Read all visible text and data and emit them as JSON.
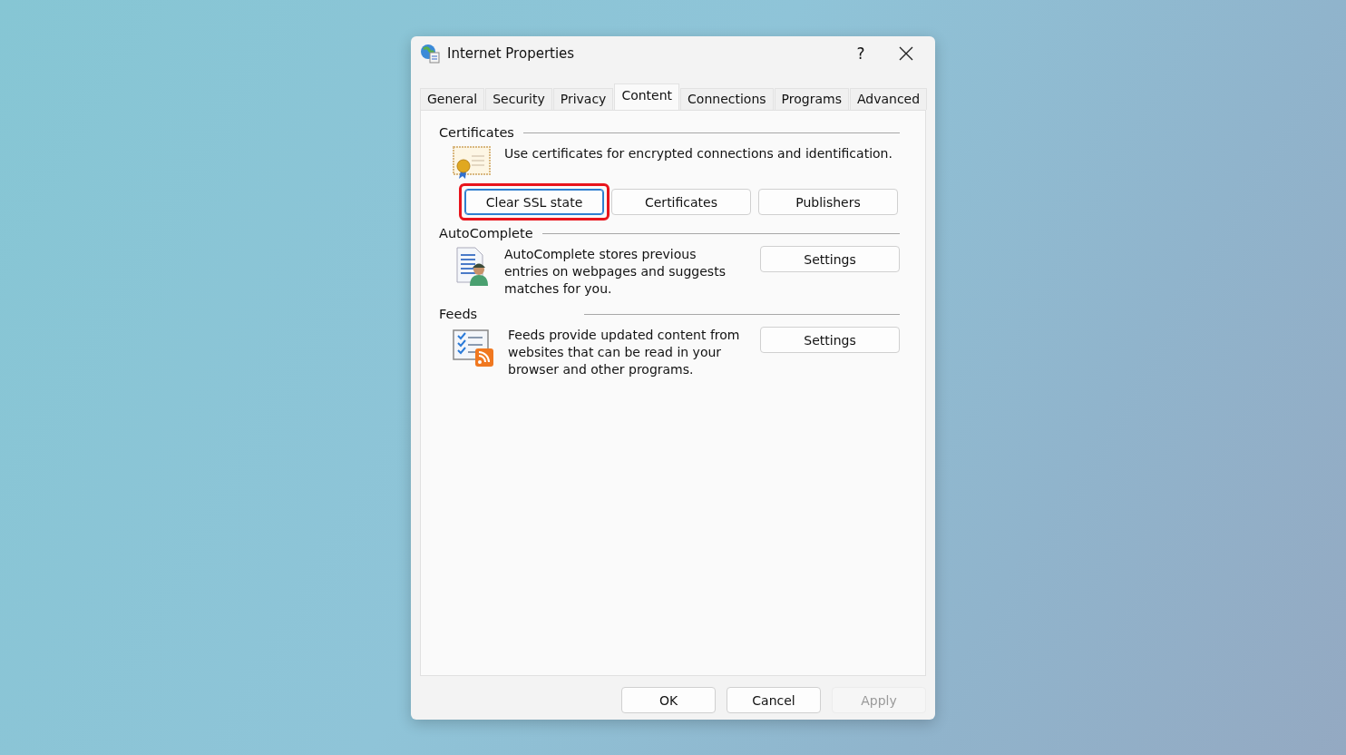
{
  "window": {
    "title": "Internet Properties",
    "help": "?"
  },
  "tabs": [
    {
      "label": "General",
      "selected": false
    },
    {
      "label": "Security",
      "selected": false
    },
    {
      "label": "Privacy",
      "selected": false
    },
    {
      "label": "Content",
      "selected": true
    },
    {
      "label": "Connections",
      "selected": false
    },
    {
      "label": "Programs",
      "selected": false
    },
    {
      "label": "Advanced",
      "selected": false
    }
  ],
  "sections": [
    {
      "kind": "certificates",
      "title": "Certificates",
      "description": "Use certificates for encrypted connections and identification.",
      "buttons": [
        {
          "label": "Clear SSL state",
          "highlighted": true
        },
        {
          "label": "Certificates",
          "highlighted": false
        },
        {
          "label": "Publishers",
          "highlighted": false
        }
      ]
    },
    {
      "kind": "autocomplete",
      "title": "AutoComplete",
      "description": "AutoComplete stores previous entries on webpages and suggests matches for you.",
      "buttons": [
        {
          "label": "Settings",
          "highlighted": false
        }
      ]
    },
    {
      "kind": "feeds",
      "title": "Feeds",
      "description": "Feeds provide updated content from websites that can be read in your browser and other programs.",
      "buttons": [
        {
          "label": "Settings",
          "highlighted": false
        }
      ]
    }
  ],
  "footer": [
    {
      "label": "OK",
      "disabled": false
    },
    {
      "label": "Cancel",
      "disabled": false
    },
    {
      "label": "Apply",
      "disabled": true
    }
  ]
}
